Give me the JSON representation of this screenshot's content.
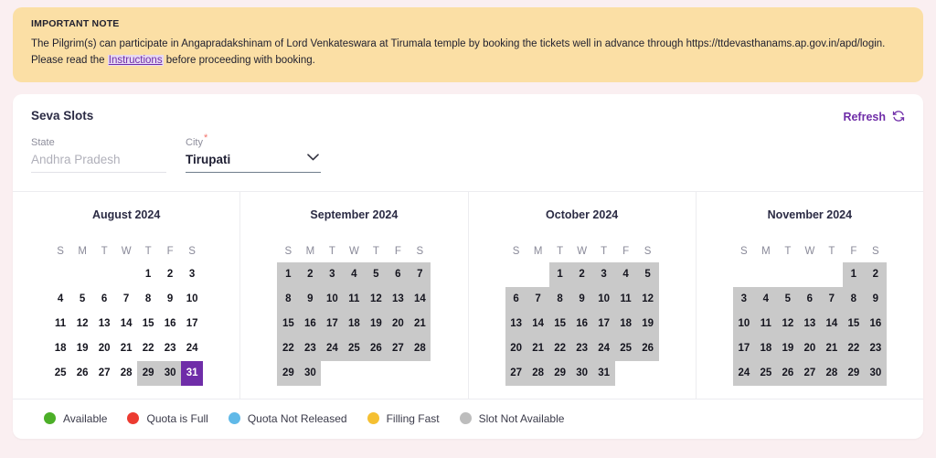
{
  "note": {
    "title": "IMPORTANT NOTE",
    "body_before": "The Pilgrim(s) can participate in Angapradakshinam of Lord Venkateswara at Tirumala temple by booking the tickets well in advance through https://ttdevasthanams.ap.gov.in/apd/login. Please read the ",
    "link_label": "Instructions",
    "body_after": " before proceeding with booking.",
    "bg_color": "#fbdfa5",
    "link_color": "#6f2da8"
  },
  "seva": {
    "title": "Seva Slots",
    "refresh_label": "Refresh",
    "refresh_icon": "refresh-icon",
    "accent_color": "#6f2da8"
  },
  "filters": {
    "state": {
      "label": "State",
      "value": "Andhra Pradesh",
      "required": false,
      "disabled": true
    },
    "city": {
      "label": "City",
      "value": "Tirupati",
      "required": true,
      "required_mark": "*",
      "disabled": false,
      "chevron_icon": "chevron-down-icon"
    }
  },
  "calendar": {
    "dow": [
      "S",
      "M",
      "T",
      "W",
      "T",
      "F",
      "S"
    ],
    "months": [
      {
        "title": "August 2024",
        "weeks": [
          [
            {
              "d": "",
              "s": "empty"
            },
            {
              "d": "",
              "s": "empty"
            },
            {
              "d": "",
              "s": "empty"
            },
            {
              "d": "",
              "s": "empty"
            },
            {
              "d": "1",
              "s": "none"
            },
            {
              "d": "2",
              "s": "none"
            },
            {
              "d": "3",
              "s": "none"
            }
          ],
          [
            {
              "d": "4",
              "s": "none"
            },
            {
              "d": "5",
              "s": "none"
            },
            {
              "d": "6",
              "s": "none"
            },
            {
              "d": "7",
              "s": "none"
            },
            {
              "d": "8",
              "s": "none"
            },
            {
              "d": "9",
              "s": "none"
            },
            {
              "d": "10",
              "s": "none"
            }
          ],
          [
            {
              "d": "11",
              "s": "none"
            },
            {
              "d": "12",
              "s": "none"
            },
            {
              "d": "13",
              "s": "none"
            },
            {
              "d": "14",
              "s": "none"
            },
            {
              "d": "15",
              "s": "none"
            },
            {
              "d": "16",
              "s": "none"
            },
            {
              "d": "17",
              "s": "none"
            }
          ],
          [
            {
              "d": "18",
              "s": "none"
            },
            {
              "d": "19",
              "s": "none"
            },
            {
              "d": "20",
              "s": "none"
            },
            {
              "d": "21",
              "s": "none"
            },
            {
              "d": "22",
              "s": "none"
            },
            {
              "d": "23",
              "s": "none"
            },
            {
              "d": "24",
              "s": "none"
            }
          ],
          [
            {
              "d": "25",
              "s": "none"
            },
            {
              "d": "26",
              "s": "none"
            },
            {
              "d": "27",
              "s": "none"
            },
            {
              "d": "28",
              "s": "none"
            },
            {
              "d": "29",
              "s": "unavailable"
            },
            {
              "d": "30",
              "s": "unavailable"
            },
            {
              "d": "31",
              "s": "selected"
            }
          ]
        ]
      },
      {
        "title": "September 2024",
        "weeks": [
          [
            {
              "d": "1",
              "s": "unavailable"
            },
            {
              "d": "2",
              "s": "unavailable"
            },
            {
              "d": "3",
              "s": "unavailable"
            },
            {
              "d": "4",
              "s": "unavailable"
            },
            {
              "d": "5",
              "s": "unavailable"
            },
            {
              "d": "6",
              "s": "unavailable"
            },
            {
              "d": "7",
              "s": "unavailable"
            }
          ],
          [
            {
              "d": "8",
              "s": "unavailable"
            },
            {
              "d": "9",
              "s": "unavailable"
            },
            {
              "d": "10",
              "s": "unavailable"
            },
            {
              "d": "11",
              "s": "unavailable"
            },
            {
              "d": "12",
              "s": "unavailable"
            },
            {
              "d": "13",
              "s": "unavailable"
            },
            {
              "d": "14",
              "s": "unavailable"
            }
          ],
          [
            {
              "d": "15",
              "s": "unavailable"
            },
            {
              "d": "16",
              "s": "unavailable"
            },
            {
              "d": "17",
              "s": "unavailable"
            },
            {
              "d": "18",
              "s": "unavailable"
            },
            {
              "d": "19",
              "s": "unavailable"
            },
            {
              "d": "20",
              "s": "unavailable"
            },
            {
              "d": "21",
              "s": "unavailable"
            }
          ],
          [
            {
              "d": "22",
              "s": "unavailable"
            },
            {
              "d": "23",
              "s": "unavailable"
            },
            {
              "d": "24",
              "s": "unavailable"
            },
            {
              "d": "25",
              "s": "unavailable"
            },
            {
              "d": "26",
              "s": "unavailable"
            },
            {
              "d": "27",
              "s": "unavailable"
            },
            {
              "d": "28",
              "s": "unavailable"
            }
          ],
          [
            {
              "d": "29",
              "s": "unavailable"
            },
            {
              "d": "30",
              "s": "unavailable"
            },
            {
              "d": "",
              "s": "empty"
            },
            {
              "d": "",
              "s": "empty"
            },
            {
              "d": "",
              "s": "empty"
            },
            {
              "d": "",
              "s": "empty"
            },
            {
              "d": "",
              "s": "empty"
            }
          ]
        ]
      },
      {
        "title": "October 2024",
        "weeks": [
          [
            {
              "d": "",
              "s": "empty"
            },
            {
              "d": "",
              "s": "empty"
            },
            {
              "d": "1",
              "s": "unavailable"
            },
            {
              "d": "2",
              "s": "unavailable"
            },
            {
              "d": "3",
              "s": "unavailable"
            },
            {
              "d": "4",
              "s": "unavailable"
            },
            {
              "d": "5",
              "s": "unavailable"
            }
          ],
          [
            {
              "d": "6",
              "s": "unavailable"
            },
            {
              "d": "7",
              "s": "unavailable"
            },
            {
              "d": "8",
              "s": "unavailable"
            },
            {
              "d": "9",
              "s": "unavailable"
            },
            {
              "d": "10",
              "s": "unavailable"
            },
            {
              "d": "11",
              "s": "unavailable"
            },
            {
              "d": "12",
              "s": "unavailable"
            }
          ],
          [
            {
              "d": "13",
              "s": "unavailable"
            },
            {
              "d": "14",
              "s": "unavailable"
            },
            {
              "d": "15",
              "s": "unavailable"
            },
            {
              "d": "16",
              "s": "unavailable"
            },
            {
              "d": "17",
              "s": "unavailable"
            },
            {
              "d": "18",
              "s": "unavailable"
            },
            {
              "d": "19",
              "s": "unavailable"
            }
          ],
          [
            {
              "d": "20",
              "s": "unavailable"
            },
            {
              "d": "21",
              "s": "unavailable"
            },
            {
              "d": "22",
              "s": "unavailable"
            },
            {
              "d": "23",
              "s": "unavailable"
            },
            {
              "d": "24",
              "s": "unavailable"
            },
            {
              "d": "25",
              "s": "unavailable"
            },
            {
              "d": "26",
              "s": "unavailable"
            }
          ],
          [
            {
              "d": "27",
              "s": "unavailable"
            },
            {
              "d": "28",
              "s": "unavailable"
            },
            {
              "d": "29",
              "s": "unavailable"
            },
            {
              "d": "30",
              "s": "unavailable"
            },
            {
              "d": "31",
              "s": "unavailable"
            },
            {
              "d": "",
              "s": "empty"
            },
            {
              "d": "",
              "s": "empty"
            }
          ]
        ]
      },
      {
        "title": "November 2024",
        "weeks": [
          [
            {
              "d": "",
              "s": "empty"
            },
            {
              "d": "",
              "s": "empty"
            },
            {
              "d": "",
              "s": "empty"
            },
            {
              "d": "",
              "s": "empty"
            },
            {
              "d": "",
              "s": "empty"
            },
            {
              "d": "1",
              "s": "unavailable"
            },
            {
              "d": "2",
              "s": "unavailable"
            }
          ],
          [
            {
              "d": "3",
              "s": "unavailable"
            },
            {
              "d": "4",
              "s": "unavailable"
            },
            {
              "d": "5",
              "s": "unavailable"
            },
            {
              "d": "6",
              "s": "unavailable"
            },
            {
              "d": "7",
              "s": "unavailable"
            },
            {
              "d": "8",
              "s": "unavailable"
            },
            {
              "d": "9",
              "s": "unavailable"
            }
          ],
          [
            {
              "d": "10",
              "s": "unavailable"
            },
            {
              "d": "11",
              "s": "unavailable"
            },
            {
              "d": "12",
              "s": "unavailable"
            },
            {
              "d": "13",
              "s": "unavailable"
            },
            {
              "d": "14",
              "s": "unavailable"
            },
            {
              "d": "15",
              "s": "unavailable"
            },
            {
              "d": "16",
              "s": "unavailable"
            }
          ],
          [
            {
              "d": "17",
              "s": "unavailable"
            },
            {
              "d": "18",
              "s": "unavailable"
            },
            {
              "d": "19",
              "s": "unavailable"
            },
            {
              "d": "20",
              "s": "unavailable"
            },
            {
              "d": "21",
              "s": "unavailable"
            },
            {
              "d": "22",
              "s": "unavailable"
            },
            {
              "d": "23",
              "s": "unavailable"
            }
          ],
          [
            {
              "d": "24",
              "s": "unavailable"
            },
            {
              "d": "25",
              "s": "unavailable"
            },
            {
              "d": "26",
              "s": "unavailable"
            },
            {
              "d": "27",
              "s": "unavailable"
            },
            {
              "d": "28",
              "s": "unavailable"
            },
            {
              "d": "29",
              "s": "unavailable"
            },
            {
              "d": "30",
              "s": "unavailable"
            }
          ]
        ]
      }
    ]
  },
  "legend": [
    {
      "label": "Available",
      "color": "#4caf28"
    },
    {
      "label": "Quota is Full",
      "color": "#ec3b31"
    },
    {
      "label": "Quota Not Released",
      "color": "#60b9e8"
    },
    {
      "label": "Filling Fast",
      "color": "#f5c032"
    },
    {
      "label": "Slot Not Available",
      "color": "#bdbdbd"
    }
  ],
  "colors": {
    "page_bg": "#faeff1",
    "unavailable_cell": "#c9c9c9",
    "selected_cell": "#6f2da8"
  }
}
